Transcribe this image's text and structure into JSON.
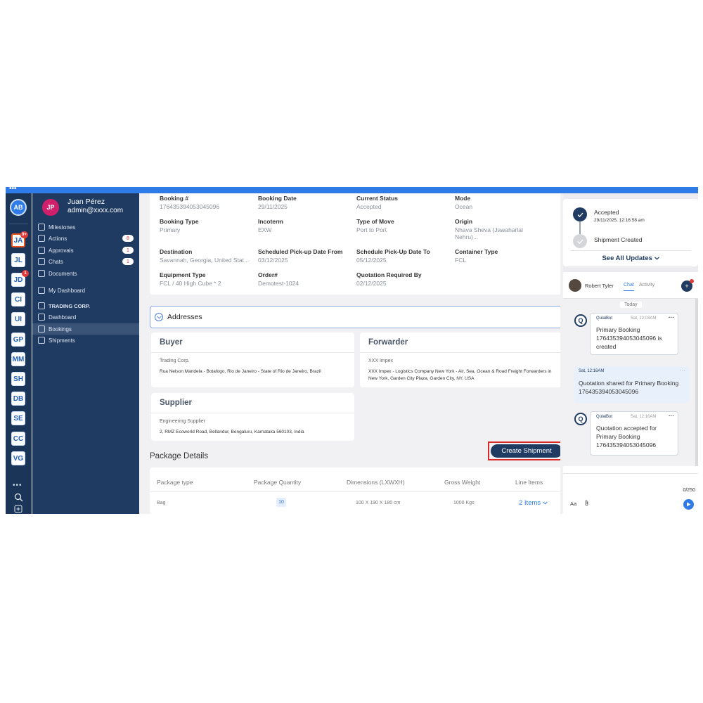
{
  "rail": {
    "top_avatar": "AB",
    "workspaces": [
      {
        "label": "JA",
        "badge": "9+"
      },
      {
        "label": "JL",
        "badge": ""
      },
      {
        "label": "JD",
        "badge": "1"
      },
      {
        "label": "CI",
        "badge": ""
      },
      {
        "label": "UI",
        "badge": ""
      },
      {
        "label": "GP",
        "badge": ""
      },
      {
        "label": "MM",
        "badge": ""
      },
      {
        "label": "SH",
        "badge": ""
      },
      {
        "label": "DB",
        "badge": ""
      },
      {
        "label": "SE",
        "badge": ""
      },
      {
        "label": "CC",
        "badge": ""
      },
      {
        "label": "VG",
        "badge": ""
      }
    ],
    "more": "•••"
  },
  "user": {
    "initials": "JP",
    "name": "Juan Pérez",
    "email": "admin@xxxx.com"
  },
  "nav": [
    {
      "label": "Milestones",
      "count": ""
    },
    {
      "label": "Actions",
      "count": "8"
    },
    {
      "label": "Approvals",
      "count": "1"
    },
    {
      "label": "Chats",
      "count": "1"
    },
    {
      "label": "Documents",
      "count": ""
    },
    {
      "label": "My Dashboard",
      "count": ""
    },
    {
      "label": "TRADING CORP.",
      "count": ""
    },
    {
      "label": "Dashboard",
      "count": ""
    },
    {
      "label": "Bookings",
      "count": ""
    },
    {
      "label": "Shipments",
      "count": ""
    }
  ],
  "booking": {
    "fields": [
      {
        "label": "Booking #",
        "value": "176435394053045096"
      },
      {
        "label": "Booking Date",
        "value": "29/11/2025"
      },
      {
        "label": "Current Status",
        "value": "Accepted"
      },
      {
        "label": "Mode",
        "value": "Ocean"
      },
      {
        "label": "Booking Type",
        "value": "Primary"
      },
      {
        "label": "Incoterm",
        "value": "EXW"
      },
      {
        "label": "Type of Move",
        "value": "Port to Port"
      },
      {
        "label": "Origin",
        "value": "Nhava Sheva (Jawaharlal Nehru)..."
      },
      {
        "label": "Destination",
        "value": "Savannah, Georgia, United Stat..."
      },
      {
        "label": "Scheduled Pick-up Date From",
        "value": "03/12/2025"
      },
      {
        "label": "Schedule Pick-Up Date To",
        "value": "05/12/2025"
      },
      {
        "label": "Container Type",
        "value": "FCL"
      },
      {
        "label": "Equipment Type",
        "value": "FCL / 40 High Cube * 2"
      },
      {
        "label": "Order#",
        "value": "Demotest-1024"
      },
      {
        "label": "Quotation Required By",
        "value": "02/12/2025"
      }
    ]
  },
  "addresses": {
    "title": "Addresses",
    "buyer": {
      "title": "Buyer",
      "company": "Trading Corp.",
      "address": "Rua Nelson Mandela - Botafogo, Rio de Janeiro - State of Rio de Janeiro, Brazil"
    },
    "forwarder": {
      "title": "Forwarder",
      "company": "XXX Impex",
      "address": "XXX Impex  - Logistics Company New York - Air, Sea, Ocean & Road Freight Forwarders in New York, Garden City Plaza, Garden City, NY, USA"
    },
    "supplier": {
      "title": "Supplier",
      "company": "Engineering Supplier",
      "address": "2, RMZ Ecoworld Road, Bellandur, Bengaluru, Karnataka 560103, India"
    }
  },
  "package": {
    "title": "Package Details",
    "create_label": "Create Shipment",
    "headers": [
      "Package type",
      "Package Quantity",
      "Dimensions (LXWXH)",
      "Gross Weight",
      "Line Items"
    ],
    "row": {
      "type": "Bag",
      "quantity": "10",
      "dimensions": "100 X 190 X 180 cm",
      "weight": "1000 Kgs",
      "items": "2 Items"
    }
  },
  "timeline": {
    "status1": "Accepted",
    "date1": "29/11/2025, 12:16:58 am",
    "status2": "Shipment Created",
    "see_all": "See All Updates"
  },
  "chat": {
    "name": "Robert Tyler",
    "tab_chat": "Chat",
    "tab_activity": "Activity",
    "today": "Today",
    "messages": [
      {
        "from": "QulaiBot",
        "time": "Sat, 12:03AM",
        "body": "Primary Booking 176435394053045096 is created"
      },
      {
        "from": "",
        "time": "Sat, 12:16AM",
        "body": "Quotation shared for Primary Booking 176435394053045096"
      },
      {
        "from": "QulaiBot",
        "time": "Sat, 12:16AM",
        "body": "Quotation accepted for Primary Booking 176435394053045096"
      }
    ],
    "counter": "0/250",
    "format_label": "Aa"
  }
}
